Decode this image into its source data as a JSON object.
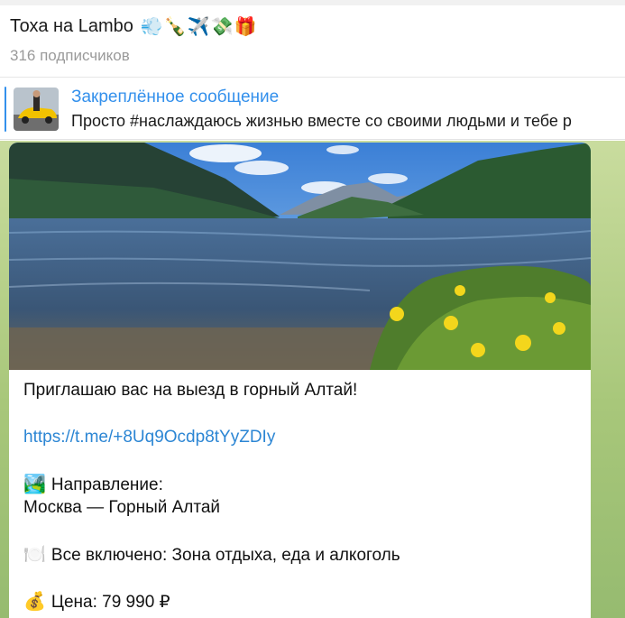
{
  "channel": {
    "title": "Тоха на Lambo",
    "emojis": [
      "💨",
      "🍾",
      "✈️",
      "💸",
      "🎁"
    ],
    "subscribers": "316 подписчиков"
  },
  "pinned": {
    "label": "Закреплённое сообщение",
    "text": "Просто #наслаждаюсь жизнью вместе со своими людьми и тебе р"
  },
  "message": {
    "intro": "Приглашаю вас на выезд в горный Алтай!",
    "link": "https://t.me/+8Uq9Ocdp8tYyZDIy",
    "direction_icon": "🏞️",
    "direction_label": "Направление:",
    "direction_value": "Москва — Горный Алтай",
    "included_icon": "🍽️",
    "included_text": "Все включено: Зона отдыха, еда и алкоголь",
    "price_icon": "💰",
    "price_text": "Цена: 79 990 ₽"
  },
  "colors": {
    "accent": "#3390ec",
    "link": "#2c86d4",
    "chat_background": "#b3cf87"
  }
}
